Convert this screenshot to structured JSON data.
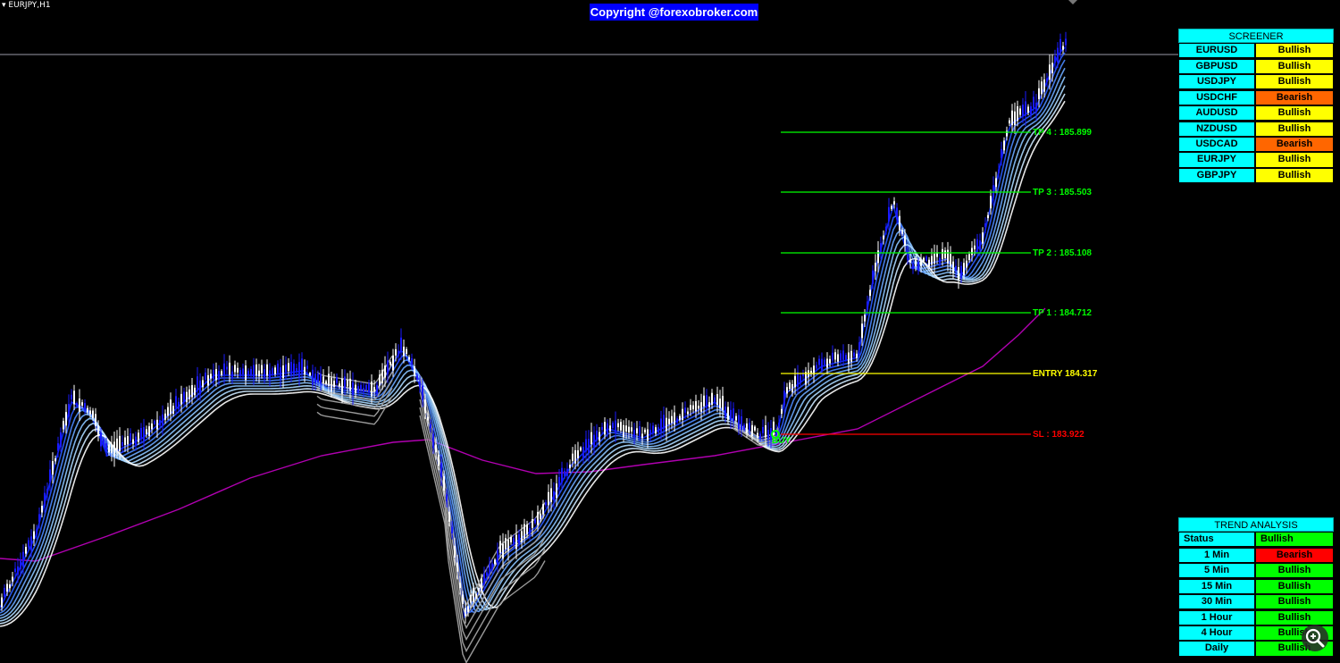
{
  "window": {
    "symbol": "EURJPY,H1"
  },
  "watermark": {
    "text": "Copyright @forexobroker.com",
    "bg": "#0000ff"
  },
  "colors": {
    "bull": "#ffff00",
    "bear": "#ff6600",
    "green": "#00ff00",
    "red": "#ff0000",
    "cyan": "#00ffff",
    "tp": "#00ff00",
    "entry": "#ffff00",
    "sl": "#ff0000",
    "ma": "#b000b0"
  },
  "levels": {
    "tp4": "TP 4 : 185.899",
    "tp3": "TP 3 : 185.503",
    "tp2": "TP 2 : 185.108",
    "tp1": "TP 1 : 184.712",
    "entry": "ENTRY 184.317",
    "sl": "SL : 183.922",
    "buy_label": "BUY"
  },
  "screener": {
    "title": "SCREENER",
    "rows": [
      {
        "pair": "EURUSD",
        "signal": "Bullish"
      },
      {
        "pair": "GBPUSD",
        "signal": "Bullish"
      },
      {
        "pair": "USDJPY",
        "signal": "Bullish"
      },
      {
        "pair": "USDCHF",
        "signal": "Bearish"
      },
      {
        "pair": "AUDUSD",
        "signal": "Bullish"
      },
      {
        "pair": "NZDUSD",
        "signal": "Bullish"
      },
      {
        "pair": "USDCAD",
        "signal": "Bearish"
      },
      {
        "pair": "EURJPY",
        "signal": "Bullish"
      },
      {
        "pair": "GBPJPY",
        "signal": "Bullish"
      }
    ]
  },
  "trend": {
    "title": "TREND ANALYSIS",
    "rows": [
      {
        "tf": "Status",
        "signal": "Bullish"
      },
      {
        "tf": "1 Min",
        "signal": "Bearish"
      },
      {
        "tf": "5 Min",
        "signal": "Bullish"
      },
      {
        "tf": "15 Min",
        "signal": "Bullish"
      },
      {
        "tf": "30 Min",
        "signal": "Bullish"
      },
      {
        "tf": "1 Hour",
        "signal": "Bullish"
      },
      {
        "tf": "4 Hour",
        "signal": "Bullish"
      },
      {
        "tf": "Daily",
        "signal": "Bullish"
      }
    ]
  },
  "icons": {
    "zoom": "zoom-in-icon",
    "scroll": "chevron-down-icon"
  }
}
